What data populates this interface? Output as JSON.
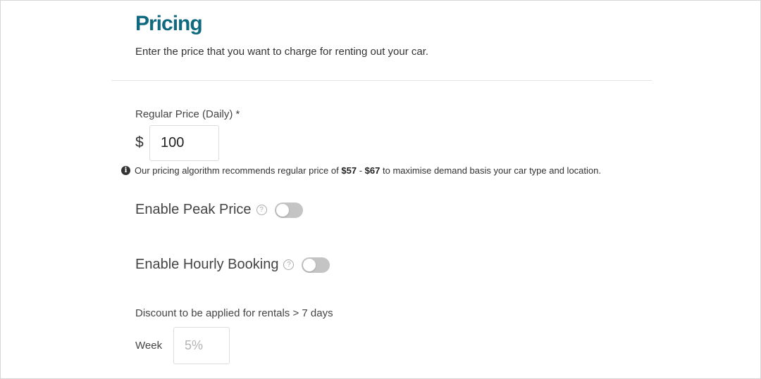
{
  "section": {
    "title": "Pricing",
    "subtitle": "Enter the price that you want to charge for renting out your car."
  },
  "regular_price": {
    "label": "Regular Price (Daily) *",
    "currency": "$",
    "value": "100"
  },
  "recommendation": {
    "icon": "info-icon",
    "prefix": "Our pricing algorithm recommends regular price of",
    "low": "$57",
    "separator": "-",
    "high": "$67",
    "suffix": "to maximise demand basis your car type and location."
  },
  "toggles": {
    "peak_price": {
      "label": "Enable Peak Price",
      "help_glyph": "?",
      "enabled": false
    },
    "hourly_booking": {
      "label": "Enable Hourly Booking",
      "help_glyph": "?",
      "enabled": false
    }
  },
  "discount": {
    "label": "Discount to be applied for rentals > 7 days",
    "week_label": "Week",
    "week_placeholder": "5%",
    "week_value": ""
  },
  "colors": {
    "title": "#0f6a80",
    "toggle_off": "#c4c4c4"
  }
}
